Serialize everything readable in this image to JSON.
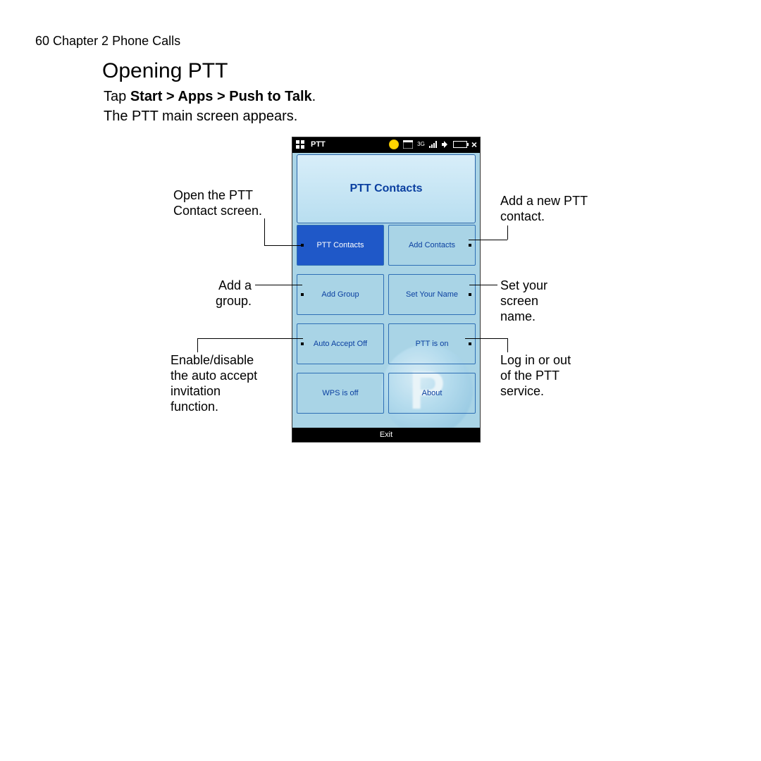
{
  "page": {
    "header": "60  Chapter 2  Phone Calls",
    "title": "Opening PTT",
    "line1_pre": "Tap ",
    "line1_bold": "Start > Apps > Push to Talk",
    "line1_post": ".",
    "line2": "The PTT main screen appears."
  },
  "phone": {
    "status_title": "PTT",
    "heading": "PTT Contacts",
    "tiles": {
      "ptt_contacts": "PTT Contacts",
      "add_contacts": "Add Contacts",
      "add_group": "Add Group",
      "set_your_name": "Set Your Name",
      "auto_accept_off": "Auto Accept Off",
      "ptt_is_on": "PTT is on",
      "wps_is_off": "WPS is off",
      "about": "About"
    },
    "exit": "Exit"
  },
  "callouts": {
    "open_contacts_1": "Open the PTT",
    "open_contacts_2": "Contact screen.",
    "add_group_1": "Add a",
    "add_group_2": "group.",
    "auto_1": "Enable/disable",
    "auto_2": "the auto accept",
    "auto_3": "invitation",
    "auto_4": "function.",
    "add_contact_1": "Add a new PTT",
    "add_contact_2": "contact.",
    "set_name_1": "Set your",
    "set_name_2": "screen",
    "set_name_3": "name.",
    "login_1": "Log in or out",
    "login_2": "of the PTT",
    "login_3": "service."
  }
}
